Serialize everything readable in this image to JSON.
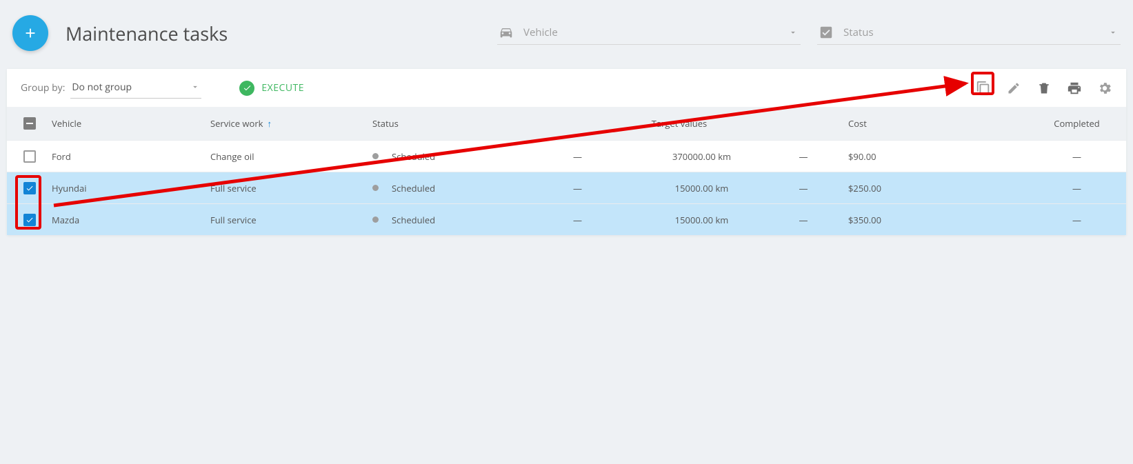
{
  "header": {
    "title": "Maintenance tasks",
    "filters": {
      "vehicle_placeholder": "Vehicle",
      "status_placeholder": "Status"
    }
  },
  "toolbar": {
    "group_by_label": "Group by:",
    "group_select_value": "Do not group",
    "execute_label": "EXECUTE"
  },
  "table": {
    "headers": {
      "vehicle": "Vehicle",
      "service_work": "Service work",
      "status": "Status",
      "target_values": "Target values",
      "cost": "Cost",
      "completed": "Completed"
    },
    "rows": [
      {
        "checked": false,
        "vehicle": "Ford",
        "service": "Change oil",
        "status": "Scheduled",
        "tv1": "—",
        "tv2": "370000.00 km",
        "tv3": "—",
        "cost": "$90.00",
        "completed": "—"
      },
      {
        "checked": true,
        "vehicle": "Hyundai",
        "service": "Full service",
        "status": "Scheduled",
        "tv1": "—",
        "tv2": "15000.00 km",
        "tv3": "—",
        "cost": "$250.00",
        "completed": "—"
      },
      {
        "checked": true,
        "vehicle": "Mazda",
        "service": "Full service",
        "status": "Scheduled",
        "tv1": "—",
        "tv2": "15000.00 km",
        "tv3": "—",
        "cost": "$350.00",
        "completed": "—"
      }
    ]
  }
}
